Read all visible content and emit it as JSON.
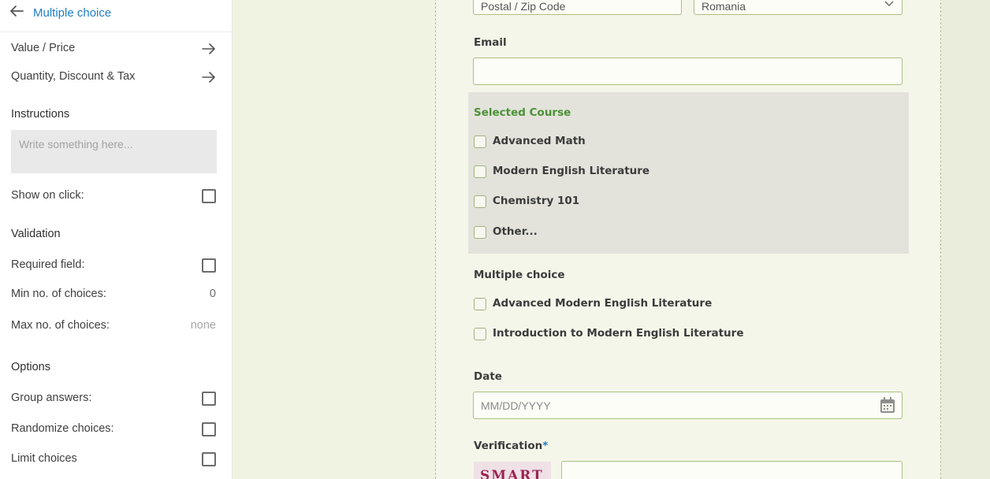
{
  "sidebar": {
    "title": "Multiple choice",
    "links": [
      {
        "label": "Value / Price"
      },
      {
        "label": "Quantity, Discount & Tax"
      }
    ],
    "instructions": {
      "heading": "Instructions",
      "placeholder": "Write something here...",
      "show_on_click_label": "Show on click:"
    },
    "validation": {
      "heading": "Validation",
      "required_label": "Required field:",
      "min_label": "Min no. of choices:",
      "min_value": "0",
      "max_label": "Max no. of choices:",
      "max_value": "none"
    },
    "options": {
      "heading": "Options",
      "group_label": "Group answers:",
      "randomize_label": "Randomize choices:",
      "limit_label": "Limit choices"
    }
  },
  "form": {
    "postal_placeholder": "Postal / Zip Code",
    "country_value": "Romania",
    "email_label": "Email",
    "selected_course": {
      "title": "Selected Course",
      "options": [
        "Advanced Math",
        "Modern English Literature",
        "Chemistry 101",
        "Other..."
      ]
    },
    "multiple_choice": {
      "title": "Multiple choice",
      "options": [
        "Advanced Modern English Literature",
        "Introduction to Modern English Literature"
      ]
    },
    "date_label": "Date",
    "date_placeholder": "MM/DD/YYYY",
    "verification_label": "Verification",
    "verification_required_mark": "*",
    "captcha_text": "SMART"
  },
  "colors": {
    "accent": "#1f7ec4",
    "course_title": "#4b9135",
    "field_border": "#a9c080",
    "course_block_bg": "#e3e3dc",
    "canvas_bg": "#f0f2e2"
  }
}
